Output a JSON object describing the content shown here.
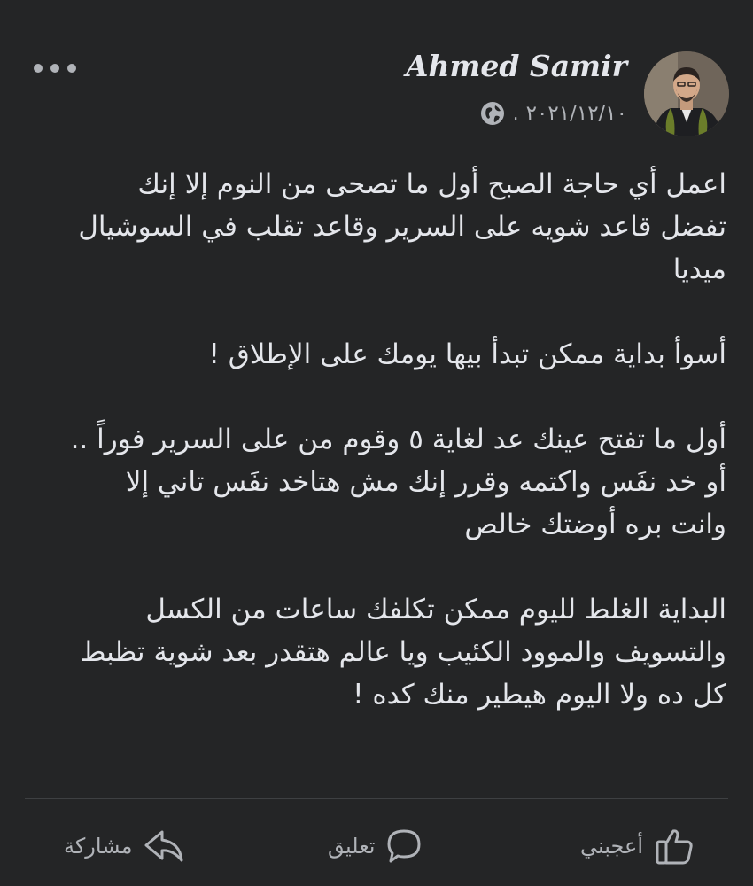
{
  "post": {
    "author": "Ahmed Samir",
    "date": "٢٠٢١/١٢/١٠",
    "separator": ".",
    "privacy_icon": "globe-icon",
    "avatar_description": "avatar-photo",
    "paragraphs": [
      "اعمل أي حاجة الصبح أول ما تصحى من النوم إلا إنك\nتفضل قاعد شويه على السرير وقاعد تقلب في السوشيال\nميديا",
      "أسوأ بداية ممكن تبدأ بيها يومك على الإطلاق !",
      "أول ما تفتح عينك عد لغاية ٥ وقوم من على السرير فوراً ..\nأو خد نفَس واكتمه وقرر إنك مش هتاخد نفَس تاني إلا\nوانت بره أوضتك خالص",
      "البداية الغلط لليوم ممكن تكلفك ساعات من الكسل\nوالتسويف والموود الكئيب ويا عالم هتقدر بعد شوية تظبط\nكل ده ولا اليوم هيطير منك كده !"
    ]
  },
  "actions": {
    "like_label": "أعجبني",
    "comment_label": "تعليق",
    "share_label": "مشاركة"
  },
  "colors": {
    "background": "#242526",
    "primary_text": "#e4e6eb",
    "secondary_text": "#b0b3b8",
    "divider": "#3e4042"
  }
}
